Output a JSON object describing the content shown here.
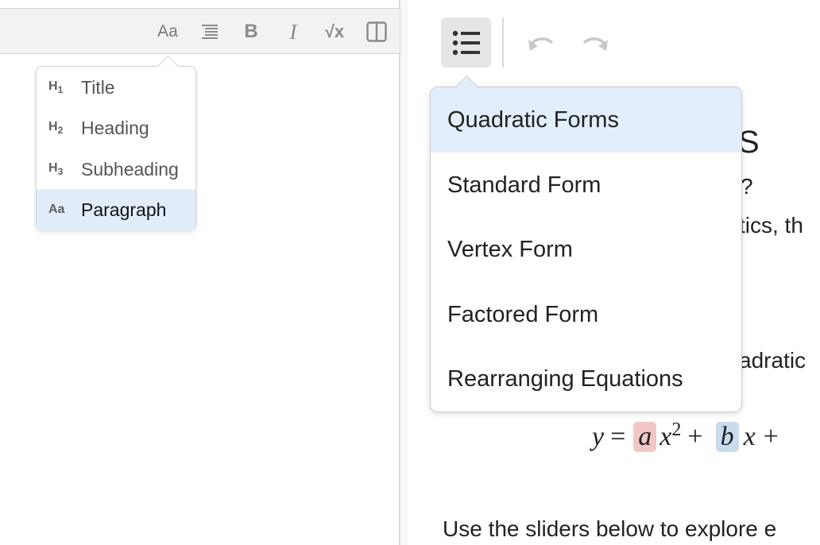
{
  "left_toolbar": {
    "buttons": [
      {
        "name": "text-style",
        "label": "Aa"
      },
      {
        "name": "align",
        "icon": "align-left-icon"
      },
      {
        "name": "bold",
        "label": "B"
      },
      {
        "name": "italic",
        "label": "I"
      },
      {
        "name": "math",
        "label": "√x"
      },
      {
        "name": "split-view",
        "icon": "split-pane-icon"
      }
    ]
  },
  "format_menu": {
    "items": [
      {
        "icon": "H",
        "sub": "1",
        "label": "Title"
      },
      {
        "icon": "H",
        "sub": "2",
        "label": "Heading"
      },
      {
        "icon": "H",
        "sub": "3",
        "label": "Subheading"
      },
      {
        "icon": "Aa",
        "sub": "",
        "label": "Paragraph",
        "selected": true
      }
    ]
  },
  "right_toolbar": {
    "toc_icon": "list-icon",
    "undo_icon": "undo-icon",
    "redo_icon": "redo-icon"
  },
  "toc_menu": {
    "items": [
      {
        "label": "Quadratic Forms",
        "active": true
      },
      {
        "label": "Standard Form"
      },
      {
        "label": "Vertex Form"
      },
      {
        "label": "Factored Form"
      },
      {
        "label": "Rearranging Equations"
      }
    ]
  },
  "document": {
    "title_fragment": "S",
    "line1_fragment": "?",
    "line2_fragment": "tics, th",
    "line3_fragment": "adratic",
    "formula": {
      "y": "y",
      "eq": "=",
      "a": "a",
      "x1": "x",
      "exp": "2",
      "plus1": "+",
      "b": "b",
      "x2": "x",
      "plus2": "+"
    },
    "bottom_text": "Use the sliders below to explore e"
  },
  "colors": {
    "toolbar_bg": "#f2f2f2",
    "selected_bg": "#e1edfb",
    "highlight_a": "#f3c6c6",
    "highlight_b": "#c9dcee"
  }
}
